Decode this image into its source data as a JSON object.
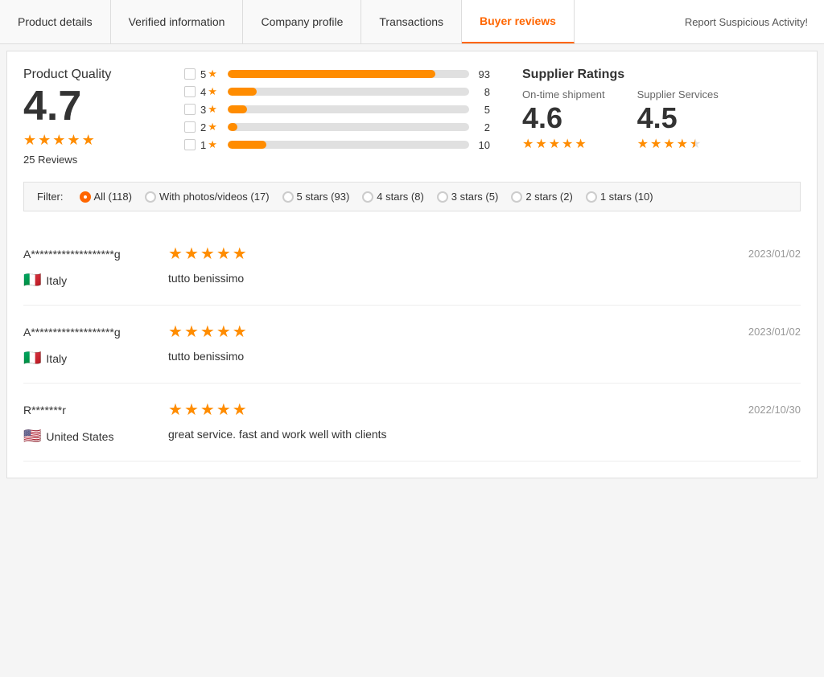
{
  "tabs": [
    {
      "id": "product-details",
      "label": "Product details",
      "active": false
    },
    {
      "id": "verified-information",
      "label": "Verified information",
      "active": false
    },
    {
      "id": "company-profile",
      "label": "Company profile",
      "active": false
    },
    {
      "id": "transactions",
      "label": "Transactions",
      "active": false
    },
    {
      "id": "buyer-reviews",
      "label": "Buyer reviews",
      "active": true
    }
  ],
  "report_button": "Report Suspicious Activity!",
  "product_quality": {
    "title": "Product Quality",
    "score": "4.7",
    "review_count": "25 Reviews",
    "stars": [
      true,
      true,
      true,
      true,
      true
    ]
  },
  "bar_chart": {
    "rows": [
      {
        "star": 5,
        "count": 93,
        "pct": 86
      },
      {
        "star": 4,
        "count": 8,
        "pct": 12
      },
      {
        "star": 3,
        "count": 5,
        "pct": 8
      },
      {
        "star": 2,
        "count": 2,
        "pct": 4
      },
      {
        "star": 1,
        "count": 10,
        "pct": 16
      }
    ]
  },
  "supplier_ratings": {
    "title": "Supplier Ratings",
    "on_time": {
      "label": "On-time shipment",
      "score": "4.6",
      "stars": [
        true,
        true,
        true,
        true,
        true
      ]
    },
    "services": {
      "label": "Supplier Services",
      "score": "4.5",
      "stars": [
        true,
        true,
        true,
        true,
        "half"
      ]
    }
  },
  "filter": {
    "label": "Filter:",
    "options": [
      {
        "id": "all",
        "label": "All (118)",
        "selected": true
      },
      {
        "id": "photos",
        "label": "With photos/videos (17)",
        "selected": false
      },
      {
        "id": "5stars",
        "label": "5 stars (93)",
        "selected": false
      },
      {
        "id": "4stars",
        "label": "4 stars (8)",
        "selected": false
      },
      {
        "id": "3stars",
        "label": "3 stars (5)",
        "selected": false
      },
      {
        "id": "2stars",
        "label": "2 stars (2)",
        "selected": false
      },
      {
        "id": "1stars",
        "label": "1 stars (10)",
        "selected": false
      }
    ]
  },
  "reviews": [
    {
      "id": "r1",
      "name": "A*******************g",
      "stars": 5,
      "date": "2023/01/02",
      "country_flag": "🇮🇹",
      "country": "Italy",
      "text": "tutto benissimo"
    },
    {
      "id": "r2",
      "name": "A*******************g",
      "stars": 5,
      "date": "2023/01/02",
      "country_flag": "🇮🇹",
      "country": "Italy",
      "text": "tutto benissimo"
    },
    {
      "id": "r3",
      "name": "R*******r",
      "stars": 5,
      "date": "2022/10/30",
      "country_flag": "🇺🇸",
      "country": "United States",
      "text": "great service. fast and work well with clients"
    }
  ],
  "colors": {
    "orange": "#ff6600",
    "star_orange": "#ff8c00",
    "tab_border": "#ff6600"
  }
}
